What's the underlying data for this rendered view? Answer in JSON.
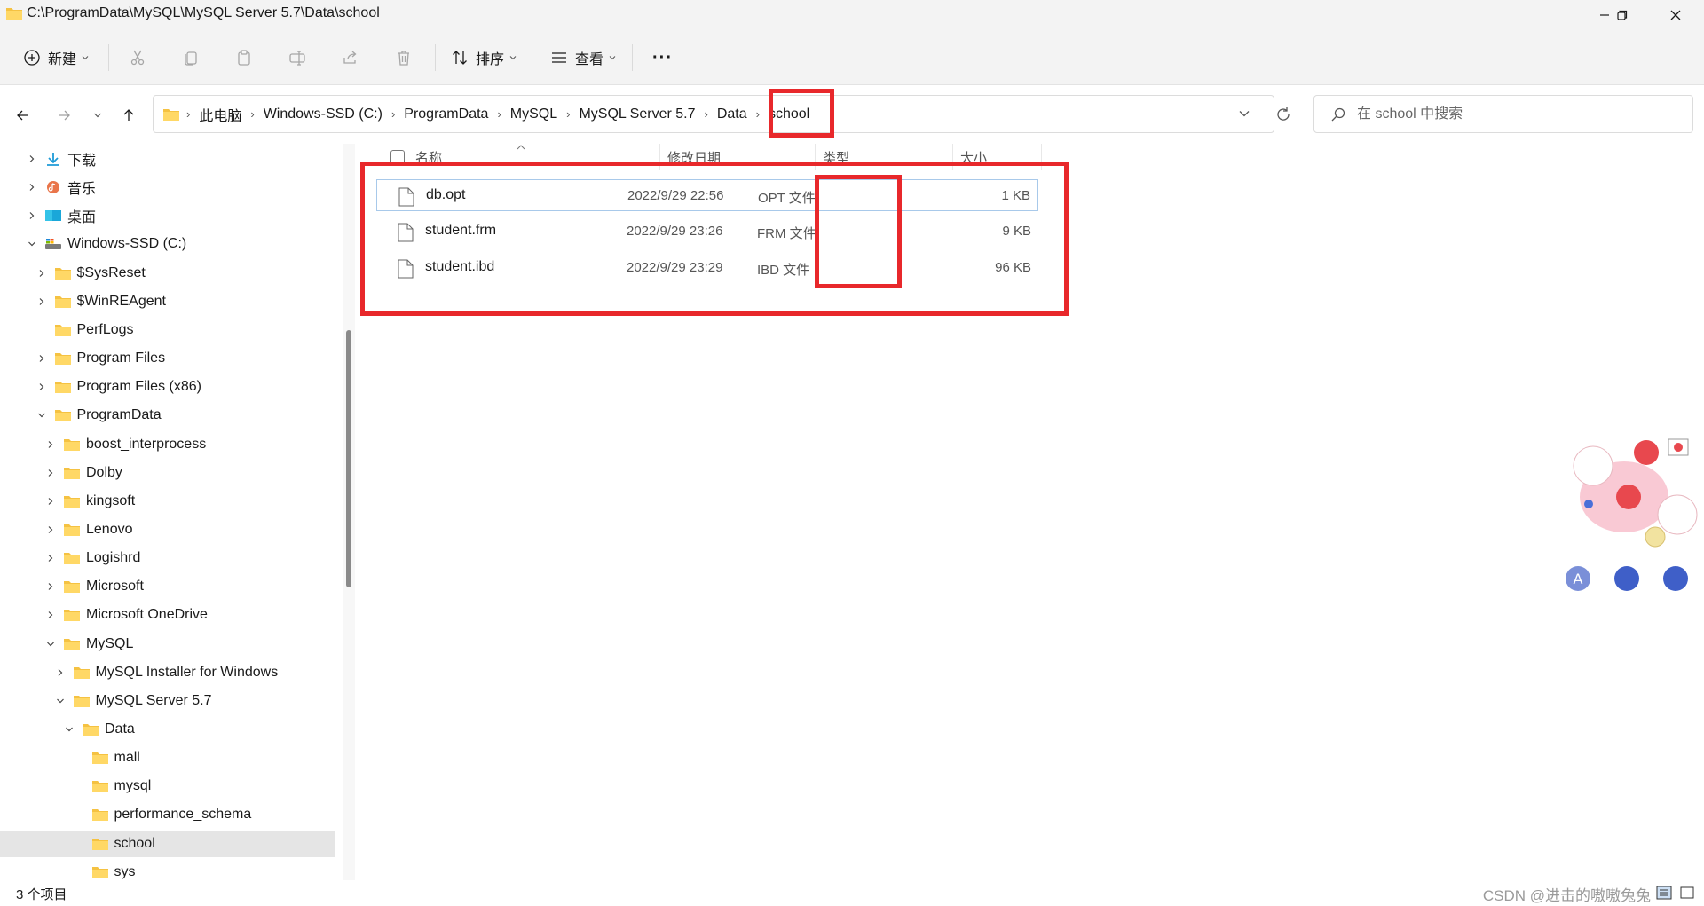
{
  "window": {
    "title": "C:\\ProgramData\\MySQL\\MySQL Server 5.7\\Data\\school",
    "minimize_icon": "minimize-icon",
    "maximize_icon": "restore-icon",
    "close_icon": "close-icon"
  },
  "toolbar": {
    "new_label": "新建",
    "sort_label": "排序",
    "view_label": "查看",
    "more_label": "···"
  },
  "nav": {
    "back_icon": "arrow-left-icon",
    "forward_icon": "arrow-right-icon",
    "recent_icon": "chevron-down-icon",
    "up_icon": "arrow-up-icon"
  },
  "breadcrumb": [
    "此电脑",
    "Windows-SSD (C:)",
    "ProgramData",
    "MySQL",
    "MySQL Server 5.7",
    "Data",
    "school"
  ],
  "search": {
    "placeholder": "在 school 中搜索"
  },
  "tree": [
    {
      "label": "下载",
      "icon": "download-icon",
      "indent": 0,
      "expander": "collapsed"
    },
    {
      "label": "音乐",
      "icon": "music-icon",
      "indent": 0,
      "expander": "collapsed"
    },
    {
      "label": "桌面",
      "icon": "desktop-icon",
      "indent": 0,
      "expander": "collapsed"
    },
    {
      "label": "Windows-SSD (C:)",
      "icon": "drive-icon",
      "indent": 0,
      "expander": "expanded"
    },
    {
      "label": "$SysReset",
      "icon": "folder-icon",
      "indent": 1,
      "expander": "collapsed"
    },
    {
      "label": "$WinREAgent",
      "icon": "folder-icon",
      "indent": 1,
      "expander": "collapsed"
    },
    {
      "label": "PerfLogs",
      "icon": "folder-icon",
      "indent": 1,
      "expander": "none"
    },
    {
      "label": "Program Files",
      "icon": "folder-icon",
      "indent": 1,
      "expander": "collapsed"
    },
    {
      "label": "Program Files (x86)",
      "icon": "folder-icon",
      "indent": 1,
      "expander": "collapsed"
    },
    {
      "label": "ProgramData",
      "icon": "folder-icon",
      "indent": 1,
      "expander": "expanded"
    },
    {
      "label": "boost_interprocess",
      "icon": "folder-icon",
      "indent": 2,
      "expander": "collapsed"
    },
    {
      "label": "Dolby",
      "icon": "folder-icon",
      "indent": 2,
      "expander": "collapsed"
    },
    {
      "label": "kingsoft",
      "icon": "folder-icon",
      "indent": 2,
      "expander": "collapsed"
    },
    {
      "label": "Lenovo",
      "icon": "folder-icon",
      "indent": 2,
      "expander": "collapsed"
    },
    {
      "label": "Logishrd",
      "icon": "folder-icon",
      "indent": 2,
      "expander": "collapsed"
    },
    {
      "label": "Microsoft",
      "icon": "folder-icon",
      "indent": 2,
      "expander": "collapsed"
    },
    {
      "label": "Microsoft OneDrive",
      "icon": "folder-icon",
      "indent": 2,
      "expander": "collapsed"
    },
    {
      "label": "MySQL",
      "icon": "folder-icon",
      "indent": 2,
      "expander": "expanded"
    },
    {
      "label": "MySQL Installer for Windows",
      "icon": "folder-icon",
      "indent": 3,
      "expander": "collapsed"
    },
    {
      "label": "MySQL Server 5.7",
      "icon": "folder-icon",
      "indent": 3,
      "expander": "expanded"
    },
    {
      "label": "Data",
      "icon": "folder-icon",
      "indent": 4,
      "expander": "expanded"
    },
    {
      "label": "mall",
      "icon": "folder-icon",
      "indent": 5,
      "expander": "none"
    },
    {
      "label": "mysql",
      "icon": "folder-icon",
      "indent": 5,
      "expander": "none"
    },
    {
      "label": "performance_schema",
      "icon": "folder-icon",
      "indent": 5,
      "expander": "none"
    },
    {
      "label": "school",
      "icon": "folder-icon",
      "indent": 5,
      "expander": "none",
      "selected": true
    },
    {
      "label": "sys",
      "icon": "folder-icon",
      "indent": 5,
      "expander": "none"
    }
  ],
  "columns": {
    "name": "名称",
    "date": "修改日期",
    "type": "类型",
    "size": "大小"
  },
  "files": [
    {
      "name": "db.opt",
      "date": "2022/9/29 22:56",
      "type": "OPT 文件",
      "size": "1 KB"
    },
    {
      "name": "student.frm",
      "date": "2022/9/29 23:26",
      "type": "FRM 文件",
      "size": "9 KB"
    },
    {
      "name": "student.ibd",
      "date": "2022/9/29 23:29",
      "type": "IBD 文件",
      "size": "96 KB"
    }
  ],
  "status": {
    "count": "3 个项目",
    "watermark": "CSDN @进击的嗷嗷兔兔"
  },
  "colors": {
    "folder": "#f5c242",
    "highlight": "#e8282b",
    "selection": "#e5e5e5",
    "focus_border": "#a8c9ea"
  }
}
